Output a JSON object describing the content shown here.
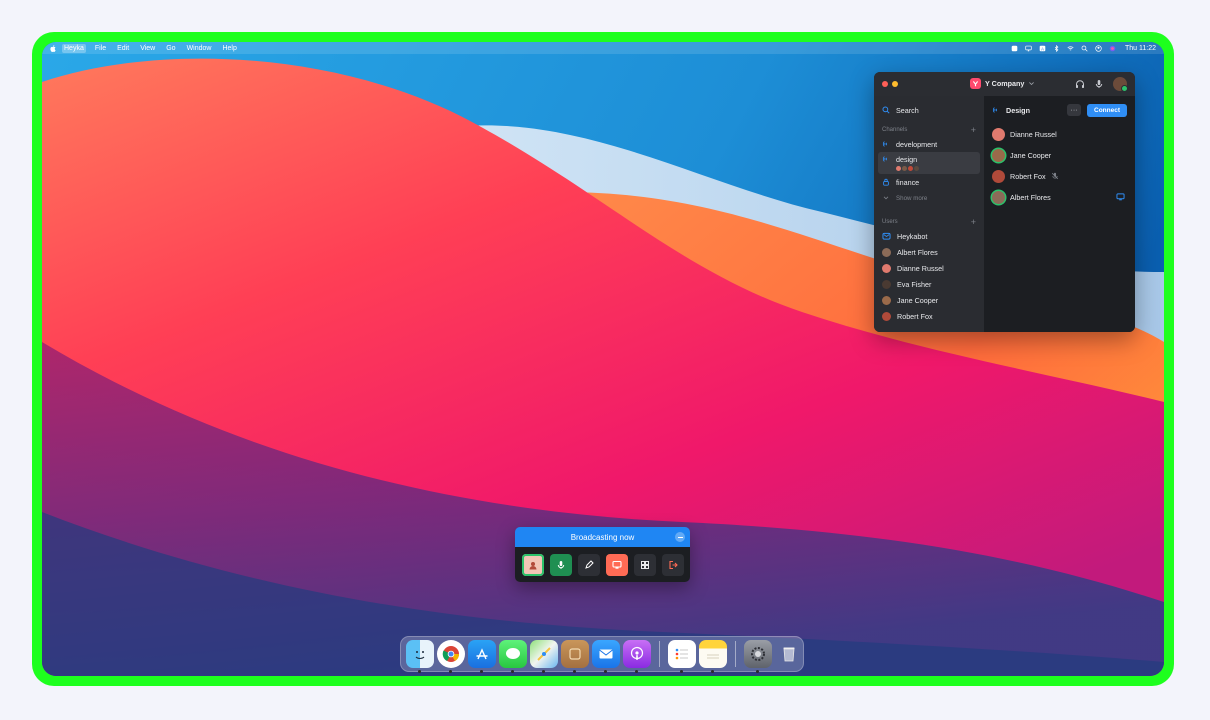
{
  "menubar": {
    "app_name": "Heyka",
    "items": [
      "File",
      "Edit",
      "View",
      "Go",
      "Window",
      "Help"
    ],
    "clock": "Thu 11:22"
  },
  "heyka": {
    "workspace": "Y Company",
    "sidebar": {
      "search_label": "Search",
      "channels_header": "Channels",
      "channels": [
        {
          "label": "development"
        },
        {
          "label": "design"
        },
        {
          "label": "finance"
        }
      ],
      "show_more_label": "Show more",
      "users_header": "Users",
      "users": [
        {
          "label": "Heykabot"
        },
        {
          "label": "Albert Flores"
        },
        {
          "label": "Dianne Russel"
        },
        {
          "label": "Eva Fisher"
        },
        {
          "label": "Jane Cooper"
        },
        {
          "label": "Robert Fox"
        }
      ]
    },
    "main": {
      "channel_title": "Design",
      "more_label": "···",
      "connect_label": "Connect",
      "members": [
        {
          "name": "Dianne Russel"
        },
        {
          "name": "Jane Cooper"
        },
        {
          "name": "Robert Fox"
        },
        {
          "name": "Albert Flores"
        }
      ]
    },
    "colors": {
      "accent": "#2f8ef5",
      "online": "#2bc26b",
      "window_bg": "#202226"
    }
  },
  "broadcast": {
    "title": "Broadcasting now",
    "controls": [
      "avatar",
      "microphone-icon",
      "pencil-icon",
      "screen-share-icon",
      "grid-icon",
      "leave-icon"
    ]
  },
  "dock": {
    "apps": [
      "finder",
      "chrome",
      "app-store",
      "messages",
      "maps",
      "heyka",
      "mail",
      "podcasts",
      "reminders",
      "notes",
      "system-preferences",
      "trash"
    ]
  }
}
